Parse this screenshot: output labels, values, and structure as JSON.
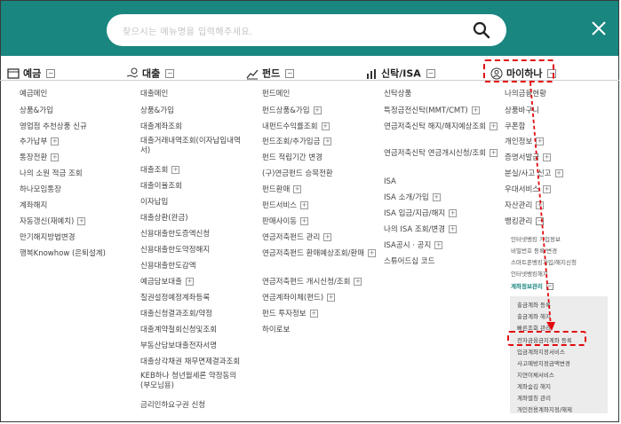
{
  "search": {
    "placeholder": "찾으시는 메뉴명을 입력해주세요."
  },
  "icons": {
    "search": "search-icon",
    "close": "close-icon"
  },
  "colors": {
    "topbar": "#1a8680",
    "highlight": "#e10b10"
  },
  "columns": {
    "deposit": {
      "title": "예금",
      "items": [
        "예금메인",
        "상품&가입",
        "영업점 추천상품 신규",
        "추가납부",
        "통장전환",
        "나의 소원 적금 조회",
        "하나모임통장",
        "계좌해지",
        "자동갱신(재예치)",
        "만기해지방법변경",
        "행복Knowhow (은퇴설계)"
      ]
    },
    "loan": {
      "title": "대출",
      "items": [
        "대출메인",
        "상품&가입",
        "대출계좌조회",
        "대출거래내역조회(이자납입내역서)",
        "대출조회",
        "대출이율조회",
        "이자납입",
        "대출상환(완금)",
        "신용대출한도증액신청",
        "신용대출한도약정해지",
        "신용대출한도감액",
        "예금담보대출",
        "질권설정예정계좌등록",
        "대출신청결과조회/약정",
        "대출계약철회신청및조회",
        "부동산담보대출전자서명",
        "대출상각채권 채무면제결과조회",
        "KEB하나 청년월세론 약정동의(부모님용)",
        "금리인하요구권 신청"
      ]
    },
    "fund": {
      "title": "펀드",
      "items": [
        "펀드메인",
        "펀드상품&가입",
        "내펀드수익률조회",
        "펀드조회/추가입금",
        "펀드 적립기간 변경",
        "(구)연금펀드 승목전환",
        "펀드환매",
        "펀드서비스",
        "판매사이동",
        "연금저축펀드 관리",
        "연금저축펀드 환매예상조회/환매",
        "연금저축펀드 개시신청/조회",
        "연금계좌이체(펀드)",
        "펀드 투자정보",
        "하이로보"
      ]
    },
    "trust": {
      "title": "신탁/ISA",
      "items": [
        "신탁상품",
        "특정금전신탁(MMT/CMT)",
        "연금저축신탁 해지/해지예상조회",
        "연금저축신탁 연금개시신청/조회",
        "ISA",
        "ISA 소개/가입",
        "ISA 입금/지급/해지",
        "나의 ISA 조회/변경",
        "ISA공시 · 공지",
        "스튜어드십 코드"
      ]
    },
    "myhana": {
      "title": "마이하나",
      "items": [
        "나의금융현황",
        "상품바구니",
        "쿠폰함",
        "개인정보",
        "증명서발급",
        "분실/사고 신고",
        "우대서비스",
        "자산관리",
        "뱅킹관리"
      ],
      "banking_sub": [
        "인터넷뱅킹 가입정보",
        "비밀번호 등록/변경",
        "스마트폰뱅킹가입/해지신청",
        "인터넷뱅킹해지",
        "계좌정보관리"
      ],
      "account_sub": [
        "출금계좌 등록",
        "출금계좌 해지",
        "빠른조회 관리",
        "전자금융금지계좌 등록",
        "입금계좌지정서비스",
        "사고예방지정금액변경",
        "지연이체서비스",
        "계좌숨김 해지",
        "계좌별칭 관리",
        "개인전용계좌지정/해제"
      ]
    }
  }
}
